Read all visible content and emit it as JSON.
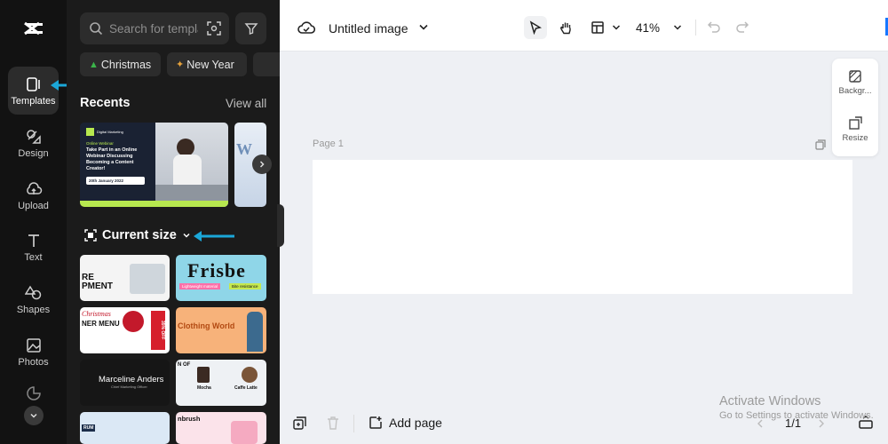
{
  "sidebar": {
    "items": [
      {
        "label": "Templates",
        "icon": "templates-icon"
      },
      {
        "label": "Design",
        "icon": "design-icon"
      },
      {
        "label": "Upload",
        "icon": "upload-icon"
      },
      {
        "label": "Text",
        "icon": "text-icon"
      },
      {
        "label": "Shapes",
        "icon": "shapes-icon"
      },
      {
        "label": "Photos",
        "icon": "photos-icon"
      }
    ]
  },
  "panel": {
    "search_placeholder": "Search for templates",
    "chips": [
      "Christmas",
      "New Year"
    ],
    "recents_title": "Recents",
    "view_all": "View all",
    "recent_card": {
      "brand": "Digital Marketing",
      "tag": "Online Webinar",
      "headline": "Take Part in an Online Webinar Discussing Becoming a Content Creator!",
      "date": "20th January 2022"
    },
    "current_size_label": "Current size",
    "grid": [
      {
        "text1": "RE",
        "text2": "PMENT"
      },
      {
        "text1": "Frisbe",
        "text2": "Lightweight material",
        "text3": "Bite resistance"
      },
      {
        "text1": "Christmas",
        "text2": "NER MENU",
        "text3": "35% OFF"
      },
      {
        "text1": "Clothing World"
      },
      {
        "text1": "Marceline Anders",
        "text2": "Chief Marketing Officer"
      },
      {
        "text1": "N OF",
        "text2": "Mocha",
        "text3": "Caffe Latte"
      },
      {
        "text1": "RUM"
      },
      {
        "text1": "nbrush"
      }
    ]
  },
  "topbar": {
    "title": "Untitled image",
    "zoom": "41%"
  },
  "canvas": {
    "page_label": "Page 1"
  },
  "side_tools": {
    "background": "Backgr...",
    "resize": "Resize"
  },
  "bottombar": {
    "add_page": "Add page",
    "page_number": "1/1"
  },
  "watermark": {
    "line1": "Activate Windows",
    "line2": "Go to Settings to activate Windows."
  },
  "colors": {
    "accent_cyan": "#1ba7d8",
    "rail_bg": "#121212",
    "panel_bg": "#1b1b1b"
  }
}
